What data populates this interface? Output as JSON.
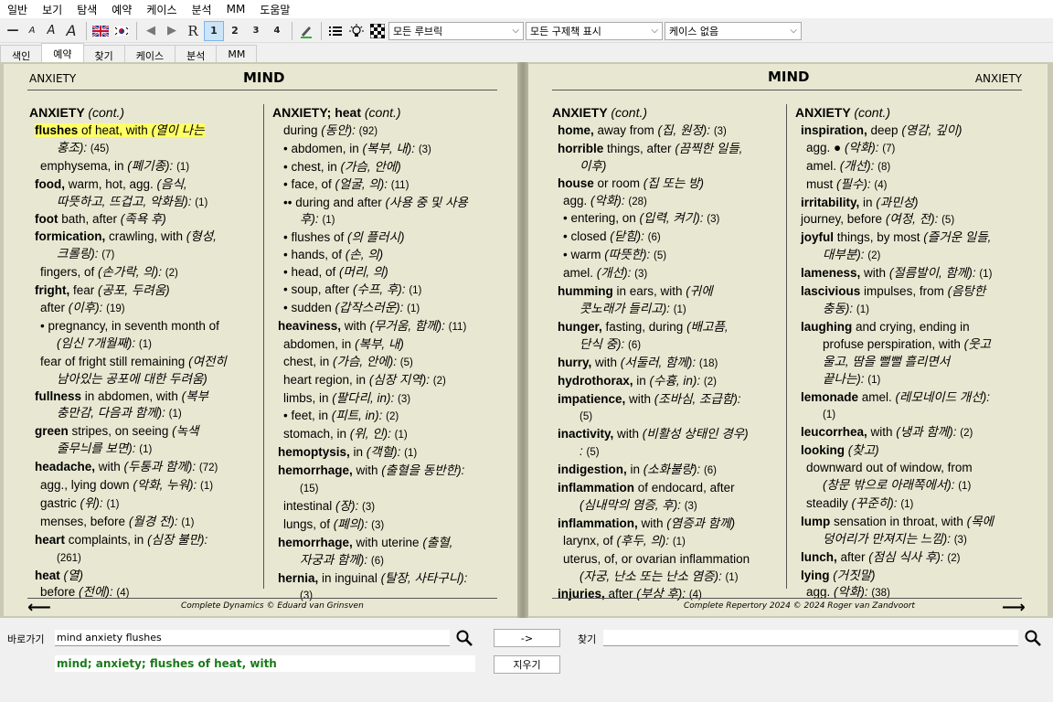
{
  "menu": [
    "일반",
    "보기",
    "탐색",
    "예약",
    "케이스",
    "분석",
    "MM",
    "도움말"
  ],
  "toolbar": {
    "font_buttons": [
      "—",
      "A",
      "A",
      "A"
    ],
    "nav": [
      "◀",
      "▶"
    ],
    "r_label": "R",
    "levels": [
      "1",
      "2",
      "3",
      "4"
    ],
    "dropdown_rubrics": "모든 루브릭",
    "dropdown_remedies": "모든 구제책 표시",
    "dropdown_case": "케이스 없음"
  },
  "tabs": [
    "색인",
    "예약",
    "찾기",
    "케이스",
    "분석",
    "MM"
  ],
  "left_page": {
    "header_left": "ANXIETY",
    "header_title": "MIND",
    "footer": "Complete Dynamics © Eduard van Grinsven",
    "col1": {
      "heading_b": "ANXIETY",
      "heading_i": "(cont.)",
      "entries": [
        {
          "t1": "flushes",
          "t2": " of heat, with ",
          "k": "(열이 나는",
          "ind": false,
          "hl": true
        },
        {
          "t1": "",
          "t2": "",
          "k": "홍조):",
          "c": "(45)",
          "ind": true,
          "cont": true
        },
        {
          "t1": "",
          "t2": "emphysema, in ",
          "k": "(폐기종):",
          "c": "(1)",
          "ind": true
        },
        {
          "t1": "food,",
          "t2": " warm, hot, agg. ",
          "k": "(음식,"
        },
        {
          "t1": "",
          "t2": "",
          "k": "따뜻하고, 뜨겁고, 악화됨):",
          "c": "(1)",
          "cont": true
        },
        {
          "t1": "foot",
          "t2": " bath, after ",
          "k": "(족욕 후)"
        },
        {
          "t1": "formication,",
          "t2": " crawling, with ",
          "k": "(형성,"
        },
        {
          "t1": "",
          "t2": "",
          "k": "크롤링):",
          "c": "(7)",
          "cont": true
        },
        {
          "t1": "",
          "t2": "fingers, of ",
          "k": "(손가락, 의):",
          "c": "(2)",
          "ind": true
        },
        {
          "t1": "fright,",
          "t2": " fear ",
          "k": "(공포, 두려움)"
        },
        {
          "t1": "",
          "t2": "after ",
          "k": "(이후):",
          "c": "(19)",
          "ind": true
        },
        {
          "t1": "",
          "t2": "• pregnancy, in seventh month of",
          "k": "",
          "ind": true
        },
        {
          "t1": "",
          "t2": "",
          "k": "(임신 7개월째):",
          "c": "(1)",
          "cont": true
        },
        {
          "t1": "",
          "t2": "fear of fright still remaining ",
          "k": "(여전히",
          "ind": true
        },
        {
          "t1": "",
          "t2": "",
          "k": "남아있는 공포에 대한 두려움)",
          "cont": true
        },
        {
          "t1": "fullness",
          "t2": " in abdomen, with ",
          "k": "(복부"
        },
        {
          "t1": "",
          "t2": "",
          "k": "충만감, 다음과 함께):",
          "c": "(1)",
          "cont": true
        },
        {
          "t1": "green",
          "t2": " stripes, on seeing ",
          "k": "(녹색"
        },
        {
          "t1": "",
          "t2": "",
          "k": "줄무늬를 보면):",
          "c": "(1)",
          "cont": true
        },
        {
          "t1": "headache,",
          "t2": " with ",
          "k": "(두통과 함께):",
          "c": "(72)"
        },
        {
          "t1": "",
          "t2": "agg., lying down ",
          "k": "(악화, 누워):",
          "c": "(1)",
          "ind": true
        },
        {
          "t1": "",
          "t2": "gastric ",
          "k": "(위):",
          "c": "(1)",
          "ind": true
        },
        {
          "t1": "",
          "t2": "menses, before ",
          "k": "(월경 전):",
          "c": "(1)",
          "ind": true
        },
        {
          "t1": "heart",
          "t2": " complaints, in ",
          "k": "(심장 불만):"
        },
        {
          "t1": "",
          "t2": "",
          "k": "",
          "c": "(261)",
          "cont": true
        },
        {
          "t1": "heat",
          "t2": " ",
          "k": "(열)"
        },
        {
          "t1": "",
          "t2": "before ",
          "k": "(전에):",
          "c": "(4)",
          "ind": true
        }
      ]
    },
    "col2": {
      "heading_b": "ANXIETY; heat",
      "heading_i": "(cont.)",
      "entries": [
        {
          "t1": "",
          "t2": "during ",
          "k": "(동안):",
          "c": "(92)",
          "ind": true
        },
        {
          "t1": "",
          "t2": "• abdomen, in ",
          "k": "(복부, 내):",
          "c": "(3)",
          "ind": true
        },
        {
          "t1": "",
          "t2": "• chest, in ",
          "k": "(가슴, 안에)",
          "ind": true
        },
        {
          "t1": "",
          "t2": "• face, of ",
          "k": "(얼굴, 의):",
          "c": "(11)",
          "ind": true
        },
        {
          "t1": "",
          "t2": "•• during and after ",
          "k": "(사용 중 및 사용",
          "ind": true
        },
        {
          "t1": "",
          "t2": "",
          "k": "후):",
          "c": "(1)",
          "cont": true
        },
        {
          "t1": "",
          "t2": "• flushes of ",
          "k": "(의 플러시)",
          "ind": true
        },
        {
          "t1": "",
          "t2": "• hands, of ",
          "k": "(손, 의)",
          "ind": true
        },
        {
          "t1": "",
          "t2": "• head, of ",
          "k": "(머리, 의)",
          "ind": true
        },
        {
          "t1": "",
          "t2": "• soup, after ",
          "k": "(수프, 후):",
          "c": "(1)",
          "ind": true
        },
        {
          "t1": "",
          "t2": "• sudden ",
          "k": "(갑작스러운):",
          "c": "(1)",
          "ind": true
        },
        {
          "t1": "heaviness,",
          "t2": " with ",
          "k": "(무거움, 함께):",
          "c": "(11)"
        },
        {
          "t1": "",
          "t2": "abdomen, in ",
          "k": "(복부, 내)",
          "ind": true
        },
        {
          "t1": "",
          "t2": "chest, in ",
          "k": "(가슴, 안에):",
          "c": "(5)",
          "ind": true
        },
        {
          "t1": "",
          "t2": "heart region, in ",
          "k": "(심장 지역):",
          "c": "(2)",
          "ind": true
        },
        {
          "t1": "",
          "t2": "limbs, in ",
          "k": "(팔다리, in):",
          "c": "(3)",
          "ind": true
        },
        {
          "t1": "",
          "t2": "• feet, in ",
          "k": "(피트, in):",
          "c": "(2)",
          "ind": true
        },
        {
          "t1": "",
          "t2": "stomach, in ",
          "k": "(위, 인):",
          "c": "(1)",
          "ind": true
        },
        {
          "t1": "hemoptysis,",
          "t2": " in ",
          "k": "(객혈):",
          "c": "(1)"
        },
        {
          "t1": "hemorrhage,",
          "t2": " with ",
          "k": "(출혈을 동반한):"
        },
        {
          "t1": "",
          "t2": "",
          "k": "",
          "c": "(15)",
          "cont": true
        },
        {
          "t1": "",
          "t2": "intestinal ",
          "k": "(장):",
          "c": "(3)",
          "ind": true
        },
        {
          "t1": "",
          "t2": "lungs, of ",
          "k": "(폐의):",
          "c": "(3)",
          "ind": true
        },
        {
          "t1": "hemorrhage,",
          "t2": " with uterine ",
          "k": "(출혈,"
        },
        {
          "t1": "",
          "t2": "",
          "k": "자궁과 함께):",
          "c": "(6)",
          "cont": true
        },
        {
          "t1": "hernia,",
          "t2": " in inguinal ",
          "k": "(탈장, 사타구니):"
        },
        {
          "t1": "",
          "t2": "",
          "k": "",
          "c": "(3)",
          "cont": true
        }
      ]
    }
  },
  "right_page": {
    "header_title": "MIND",
    "header_right": "ANXIETY",
    "footer": "Complete Repertory 2024 © 2024 Roger van Zandvoort",
    "col1": {
      "heading_b": "ANXIETY",
      "heading_i": "(cont.)",
      "entries": [
        {
          "t1": "home,",
          "t2": " away from ",
          "k": "(집, 원정):",
          "c": "(3)"
        },
        {
          "t1": "horrible",
          "t2": " things, after ",
          "k": "(끔찍한 일들,"
        },
        {
          "t1": "",
          "t2": "",
          "k": "이후)",
          "cont": true
        },
        {
          "t1": "house",
          "t2": " or room ",
          "k": "(집 또는 방)"
        },
        {
          "t1": "",
          "t2": "agg. ",
          "k": "(악화):",
          "c": "(28)",
          "ind": true
        },
        {
          "t1": "",
          "t2": "• entering, on ",
          "k": "(입력, 켜기):",
          "c": "(3)",
          "ind": true
        },
        {
          "t1": "",
          "t2": "• closed ",
          "k": "(닫힘):",
          "c": "(6)",
          "ind": true
        },
        {
          "t1": "",
          "t2": "• warm ",
          "k": "(따뜻한):",
          "c": "(5)",
          "ind": true
        },
        {
          "t1": "",
          "t2": "amel. ",
          "k": "(개선):",
          "c": "(3)",
          "ind": true
        },
        {
          "t1": "humming",
          "t2": " in ears, with ",
          "k": "(귀에"
        },
        {
          "t1": "",
          "t2": "",
          "k": "콧노래가 들리고):",
          "c": "(1)",
          "cont": true
        },
        {
          "t1": "hunger,",
          "t2": " fasting, during ",
          "k": "(배고픔,"
        },
        {
          "t1": "",
          "t2": "",
          "k": "단식 중):",
          "c": "(6)",
          "cont": true
        },
        {
          "t1": "hurry,",
          "t2": " with ",
          "k": "(서둘러, 함께):",
          "c": "(18)"
        },
        {
          "t1": "hydrothorax,",
          "t2": " in ",
          "k": "(수흉, in):",
          "c": "(2)"
        },
        {
          "t1": "impatience,",
          "t2": " with ",
          "k": "(조바심, 조급함):"
        },
        {
          "t1": "",
          "t2": "",
          "k": "",
          "c": "(5)",
          "cont": true
        },
        {
          "t1": "inactivity,",
          "t2": " with ",
          "k": "(비활성 상태인 경우)"
        },
        {
          "t1": "",
          "t2": "",
          "k": ":",
          "c": "(5)",
          "cont": true
        },
        {
          "t1": "indigestion,",
          "t2": " in ",
          "k": "(소화불량):",
          "c": "(6)"
        },
        {
          "t1": "inflammation",
          "t2": " of endocard, after",
          "k": ""
        },
        {
          "t1": "",
          "t2": "",
          "k": "(심내막의 염증, 후):",
          "c": "(3)",
          "cont": true
        },
        {
          "t1": "inflammation,",
          "t2": " with ",
          "k": "(염증과 함께)"
        },
        {
          "t1": "",
          "t2": "larynx, of ",
          "k": "(후두, 의):",
          "c": "(1)",
          "ind": true
        },
        {
          "t1": "",
          "t2": "uterus, of, or ovarian inflammation",
          "k": "",
          "ind": true
        },
        {
          "t1": "",
          "t2": "",
          "k": "(자궁, 난소 또는 난소 염증):",
          "c": "(1)",
          "cont": true
        },
        {
          "t1": "injuries,",
          "t2": " after ",
          "k": "(부상 후):",
          "c": "(4)"
        }
      ]
    },
    "col2": {
      "heading_b": "ANXIETY",
      "heading_i": "(cont.)",
      "entries": [
        {
          "t1": "inspiration,",
          "t2": " deep ",
          "k": "(영감, 깊이)"
        },
        {
          "t1": "",
          "t2": "agg. ● ",
          "k": "(악화):",
          "c": "(7)",
          "ind": true
        },
        {
          "t1": "",
          "t2": "amel. ",
          "k": "(개선):",
          "c": "(8)",
          "ind": true
        },
        {
          "t1": "",
          "t2": "must ",
          "k": "(필수):",
          "c": "(4)",
          "ind": true
        },
        {
          "t1": "irritability,",
          "t2": " in ",
          "k": "(과민성)"
        },
        {
          "t1": "",
          "t2": "journey,  before ",
          "k": "(여정, 전):",
          "c": "(5)"
        },
        {
          "t1": "joyful",
          "t2": " things, by most ",
          "k": "(즐거운 일들,"
        },
        {
          "t1": "",
          "t2": "",
          "k": "대부분):",
          "c": "(2)",
          "cont": true
        },
        {
          "t1": "lameness,",
          "t2": " with ",
          "k": "(절름발이, 함께):",
          "c": "(1)"
        },
        {
          "t1": "lascivious",
          "t2": " impulses, from ",
          "k": "(음탕한"
        },
        {
          "t1": "",
          "t2": "",
          "k": "충동):",
          "c": "(1)",
          "cont": true
        },
        {
          "t1": "laughing",
          "t2": " and crying, ending in",
          "k": ""
        },
        {
          "t1": "",
          "t2": "profuse perspiration, with ",
          "k": "(웃고",
          "cont": true
        },
        {
          "t1": "",
          "t2": "",
          "k": "울고, 땀을 뻘뻘 흘리면서",
          "cont": true
        },
        {
          "t1": "",
          "t2": "",
          "k": "끝나는):",
          "c": "(1)",
          "cont": true
        },
        {
          "t1": "lemonade",
          "t2": " amel. ",
          "k": "(레모네이드 개선):"
        },
        {
          "t1": "",
          "t2": "",
          "k": "",
          "c": "(1)",
          "cont": true
        },
        {
          "t1": "leucorrhea,",
          "t2": " with ",
          "k": "(냉과 함께):",
          "c": "(2)"
        },
        {
          "t1": "looking",
          "t2": " ",
          "k": "(찾고)"
        },
        {
          "t1": "",
          "t2": "downward out of window, from",
          "k": "",
          "ind": true
        },
        {
          "t1": "",
          "t2": "",
          "k": "(창문 밖으로 아래쪽에서):",
          "c": "(1)",
          "cont": true
        },
        {
          "t1": "",
          "t2": "steadily ",
          "k": "(꾸준히):",
          "c": "(1)",
          "ind": true
        },
        {
          "t1": "lump",
          "t2": " sensation in throat, with ",
          "k": "(목에"
        },
        {
          "t1": "",
          "t2": "",
          "k": "덩어리가 만져지는 느낌):",
          "c": "(3)",
          "cont": true
        },
        {
          "t1": "lunch,",
          "t2": " after ",
          "k": "(점심 식사 후):",
          "c": "(2)"
        },
        {
          "t1": "lying",
          "t2": " ",
          "k": "(거짓말)"
        },
        {
          "t1": "",
          "t2": "agg. ",
          "k": "(악화):",
          "c": "(38)",
          "ind": true
        }
      ]
    }
  },
  "bottom": {
    "goto_label": "바로가기",
    "goto_value": "mind anxiety flushes",
    "arrow_button": "->",
    "find_label": "찾기",
    "find_value": "",
    "clear_button": "지우기",
    "result_text": "mind; anxiety; flushes of heat, with"
  }
}
